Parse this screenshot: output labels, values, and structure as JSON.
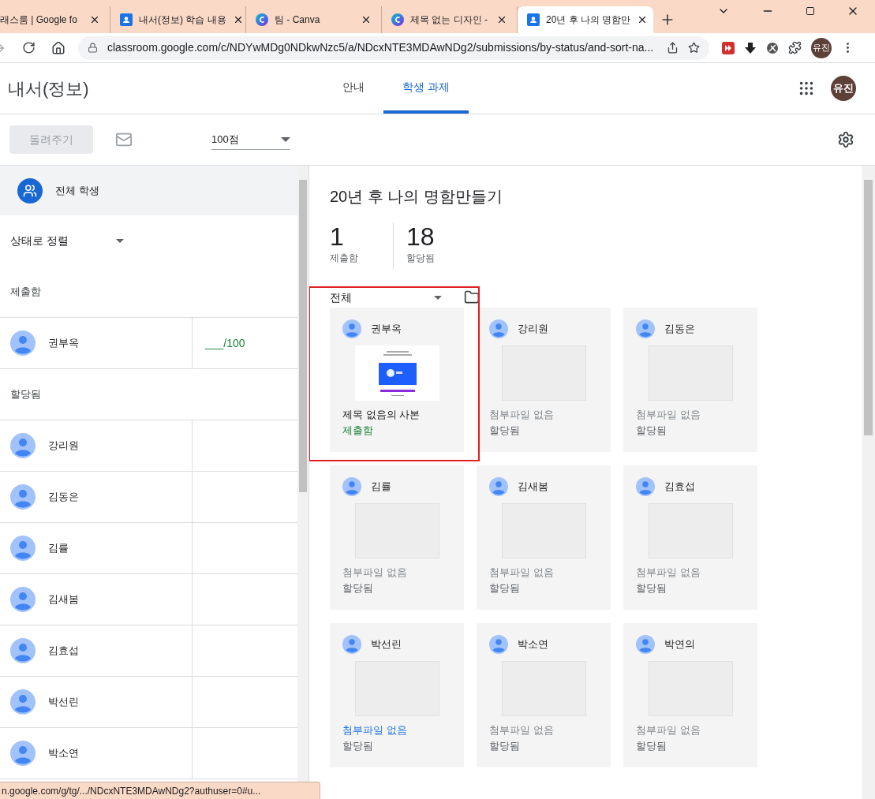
{
  "browser": {
    "tabs": [
      {
        "title": "래스룸 | Google fo",
        "selected": false
      },
      {
        "title": "내서(정보) 학습 내용",
        "kind": "classroom",
        "selected": false
      },
      {
        "title": "팀 - Canva",
        "kind": "canva",
        "selected": false
      },
      {
        "title": "제목 없는 디자인 - ",
        "kind": "canva",
        "selected": false
      },
      {
        "title": "20년 후 나의 명함만",
        "kind": "classroom",
        "selected": true
      }
    ],
    "url": "classroom.google.com/c/NDYwMDg0NDkwNzc5/a/NDcxNTE3MDAwNDg2/submissions/by-status/and-sort-na...",
    "profile": "유진"
  },
  "app": {
    "title": "내서(정보)",
    "nav": [
      {
        "label": "안내",
        "selected": false
      },
      {
        "label": "학생 과제",
        "selected": true
      }
    ],
    "profile": "유진"
  },
  "toolbar": {
    "return_button": {
      "label": "돌려주기",
      "disabled": true
    },
    "points": "100점"
  },
  "roster": {
    "all_students": "전체 학생",
    "sort": "상태로 정렬",
    "groups": [
      {
        "heading": "제출함",
        "students": [
          {
            "name": "권부옥",
            "grade": "___/100"
          }
        ]
      },
      {
        "heading": "할당됨",
        "students": [
          {
            "name": "강리원"
          },
          {
            "name": "김동은"
          },
          {
            "name": "김률"
          },
          {
            "name": "김새봄"
          },
          {
            "name": "김효섭"
          },
          {
            "name": "박선린"
          },
          {
            "name": "박소연"
          }
        ]
      }
    ]
  },
  "assignment": {
    "title": "20년 후 나의 명함만들기",
    "stats": [
      {
        "value": "1",
        "label": "제출함"
      },
      {
        "value": "18",
        "label": "할당됨"
      }
    ],
    "filter": "전체",
    "cards": [
      {
        "name": "권부옥",
        "attachment": "제목 없음의 사본",
        "status": "제출함",
        "kind": "submitted",
        "hovered": false,
        "highlighted": true
      },
      {
        "name": "강리원",
        "attachment": "첨부파일 없음",
        "status": "할당됨",
        "kind": "assigned",
        "hovered": false,
        "highlighted": false
      },
      {
        "name": "김동은",
        "attachment": "첨부파일 없음",
        "status": "할당됨",
        "kind": "assigned",
        "hovered": false,
        "highlighted": false
      },
      {
        "name": "김률",
        "attachment": "첨부파일 없음",
        "status": "할당됨",
        "kind": "assigned",
        "hovered": false,
        "highlighted": false
      },
      {
        "name": "김새봄",
        "attachment": "첨부파일 없음",
        "status": "할당됨",
        "kind": "assigned",
        "hovered": false,
        "highlighted": false
      },
      {
        "name": "김효섭",
        "attachment": "첨부파일 없음",
        "status": "할당됨",
        "kind": "assigned",
        "hovered": false,
        "highlighted": false
      },
      {
        "name": "박선린",
        "attachment": "첨부파일 없음",
        "status": "할당됨",
        "kind": "assigned",
        "hovered": true,
        "highlighted": false
      },
      {
        "name": "박소연",
        "attachment": "첨부파일 없음",
        "status": "할당됨",
        "kind": "assigned",
        "hovered": false,
        "highlighted": false
      },
      {
        "name": "박연의",
        "attachment": "첨부파일 없음",
        "status": "할당됨",
        "kind": "assigned",
        "hovered": false,
        "highlighted": false
      }
    ]
  },
  "status_bar": "n.google.com/g/tg/.../NDcxNTE3MDAwNDg2?authuser=0#u..."
}
